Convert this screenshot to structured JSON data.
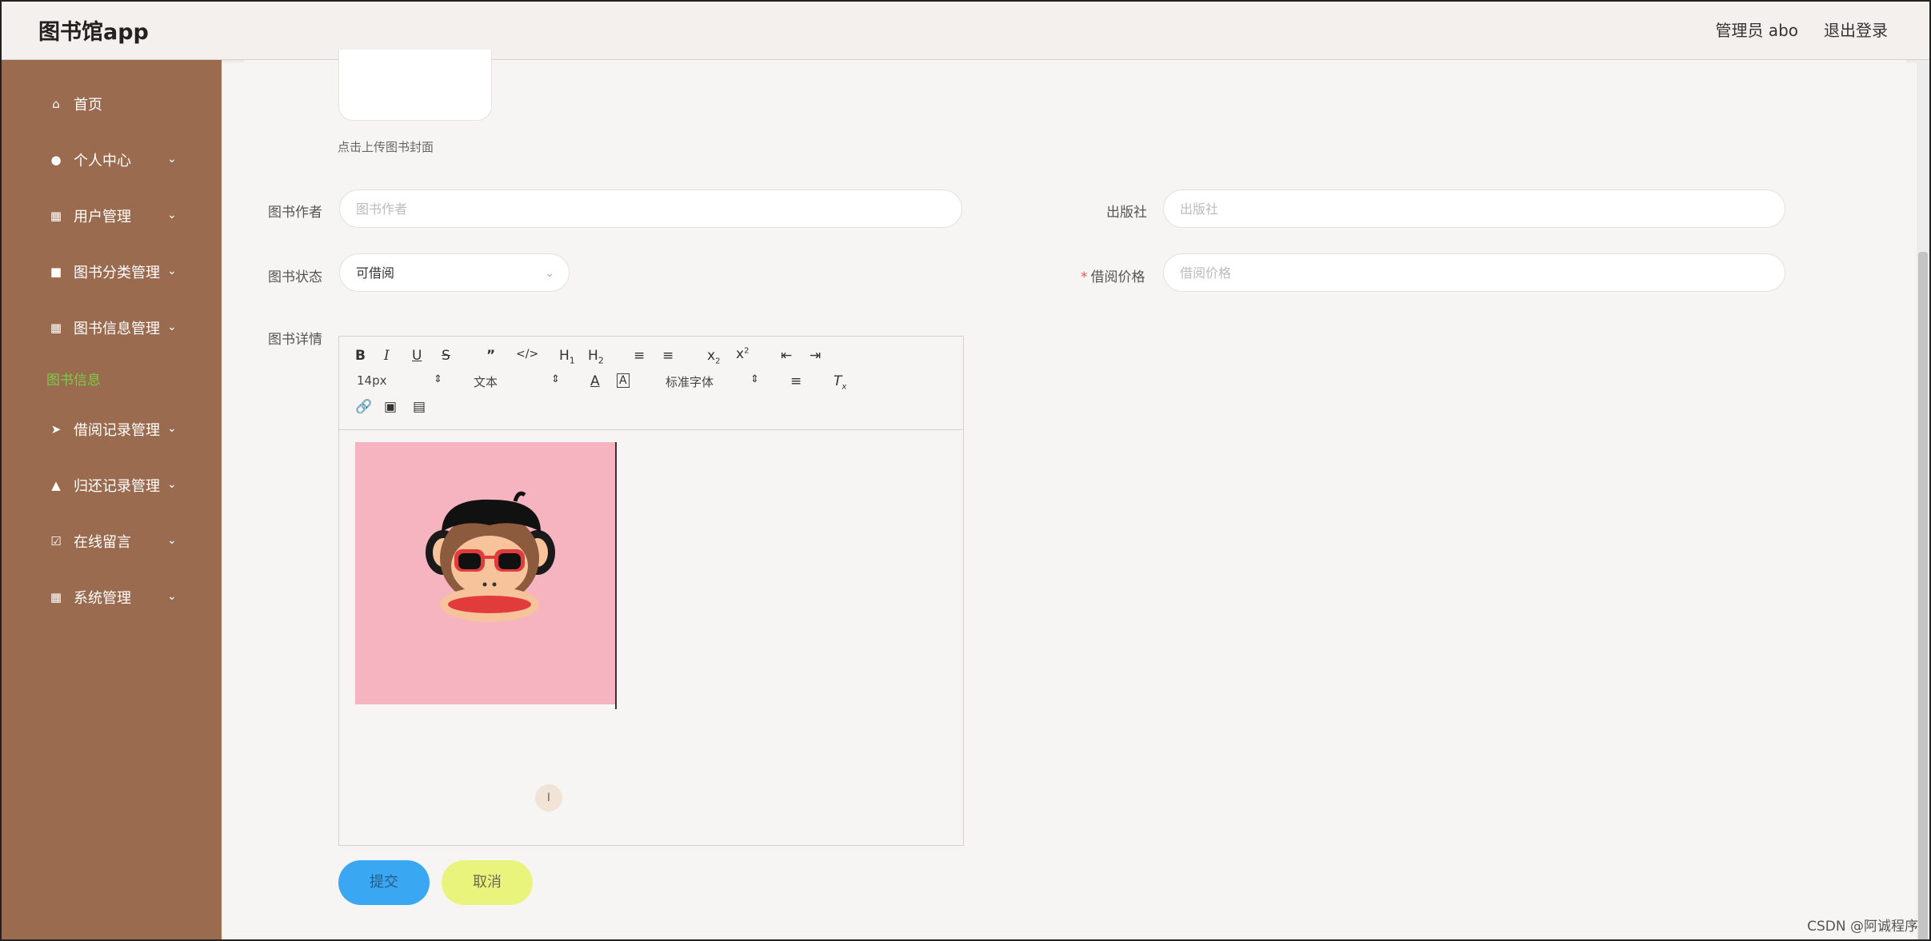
{
  "app_title": "图书馆app",
  "header": {
    "admin_label": "管理员 abo",
    "logout_label": "退出登录"
  },
  "sidebar": {
    "items": [
      {
        "label": "首页",
        "icon": "home-icon"
      },
      {
        "label": "个人中心",
        "icon": "user-icon"
      },
      {
        "label": "用户管理",
        "icon": "grid-icon"
      },
      {
        "label": "图书分类管理",
        "icon": "clipboard-icon"
      },
      {
        "label": "图书信息管理",
        "icon": "grid-icon"
      },
      {
        "label": "借阅记录管理",
        "icon": "send-icon"
      },
      {
        "label": "归还记录管理",
        "icon": "thumb-icon"
      },
      {
        "label": "在线留言",
        "icon": "checkbox-icon"
      },
      {
        "label": "系统管理",
        "icon": "table-icon"
      }
    ],
    "active_sub": "图书信息"
  },
  "form": {
    "cover_hint": "点击上传图书封面",
    "author_label": "图书作者",
    "author_placeholder": "图书作者",
    "publisher_label": "出版社",
    "publisher_placeholder": "出版社",
    "status_label": "图书状态",
    "status_value": "可借阅",
    "price_label": "借阅价格",
    "price_placeholder": "借阅价格",
    "detail_label": "图书详情"
  },
  "editor": {
    "font_size": "14px",
    "block_type": "文本",
    "font_family": "标准字体"
  },
  "buttons": {
    "submit": "提交",
    "cancel": "取消"
  },
  "watermark": "CSDN @阿诚程序"
}
